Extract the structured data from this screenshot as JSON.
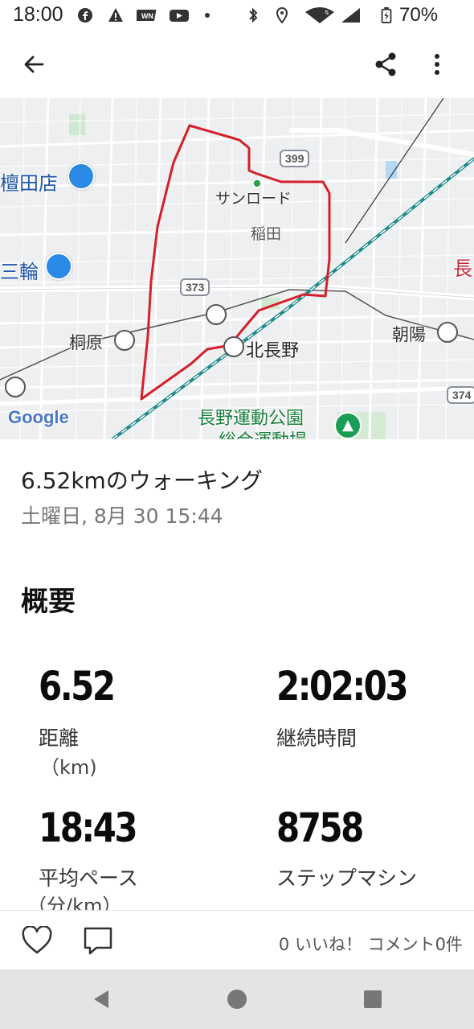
{
  "status_bar": {
    "time": "18:00",
    "battery": "70%",
    "left_icons": [
      "facebook-icon",
      "warning-icon",
      "news-icon",
      "youtube-icon",
      "dot-icon"
    ],
    "right_icons": [
      "bluetooth-icon",
      "location-icon",
      "wifi-icon",
      "signal-icon",
      "battery-icon"
    ]
  },
  "app_bar": {
    "back_icon": "arrow-left-icon",
    "share_icon": "share-icon",
    "more_icon": "more-vert-icon"
  },
  "map": {
    "labels": {
      "store1": "檀田店",
      "store2": "三輪",
      "sunroad": "サンロード",
      "inada": "稲田",
      "kirihara": "桐原",
      "kitanagano": "北長野",
      "asahi": "朝陽",
      "park1": "長野運動公園",
      "park2": "総合運動場",
      "right_edge": "長",
      "google": "Google"
    },
    "routes": {
      "r399": "399",
      "r373": "373",
      "r374": "374"
    },
    "route_color": "#d4202a",
    "rail_color": "#1e8a8a"
  },
  "activity": {
    "title": "6.52kmのウォーキング",
    "date": "土曜日, 8月 30 15:44"
  },
  "overview": {
    "heading": "概要",
    "stats": [
      {
        "value": "6.52",
        "label": "距離",
        "unit": "（km)"
      },
      {
        "value": "2:02:03",
        "label": "継続時間",
        "unit": ""
      },
      {
        "value": "18:43",
        "label": "平均ペース",
        "unit": "（分/km）"
      },
      {
        "value": "8758",
        "label": "ステップマシン",
        "unit": ""
      }
    ]
  },
  "actions": {
    "like_icon": "heart-icon",
    "comment_icon": "comment-icon",
    "counts": "0 いいね！ コメント0件"
  },
  "nav_bar": {
    "back": "nav-back-icon",
    "home": "nav-home-icon",
    "recents": "nav-recents-icon"
  }
}
